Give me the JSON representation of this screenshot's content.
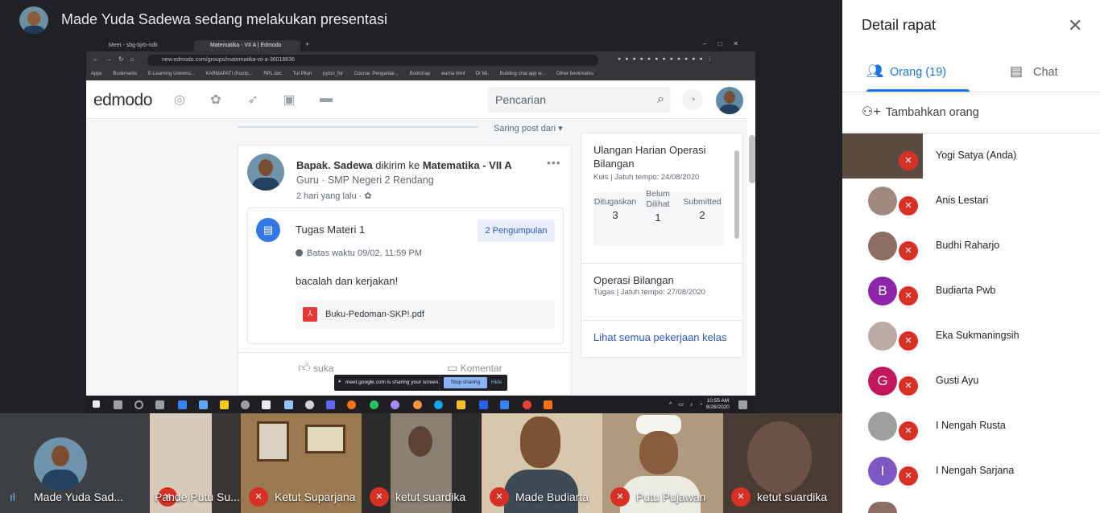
{
  "meet": {
    "presenter_title": "Made Yuda Sadewa sedang melakukan presentasi"
  },
  "browser": {
    "tabs": [
      "Meet - sbg-bjrb-ndk",
      "Matematika - VII A | Edmodo"
    ],
    "url": "new.edmodo.com/groups/matematika-vii-a-36018636",
    "bookmarks": [
      "Apps",
      "Bookmarks",
      "E-Learning Universi...",
      "KARMAPATI (Kump...",
      "RPL doc",
      "Tut Piton",
      "pyton_for",
      "Course: Pengantar...",
      "Bootstrap",
      "warna html",
      "DI ML",
      "Building chat app w...",
      "Other bookmarks"
    ]
  },
  "edmodo": {
    "logo": "edmodo",
    "search_placeholder": "Pencarian",
    "feed_filter": "Saring post dari",
    "post": {
      "author": "Bapak. Sadewa",
      "sent_to": "dikirim ke",
      "group": "Matematika - VII A",
      "role": "Guru · SMP Negeri 2 Rendang",
      "time": "2 hari yang lalu ·",
      "assignment_title": "Tugas Materi 1",
      "submissions": "2 Pengumpulan",
      "due": "Batas waktu 09/02, 11:59 PM",
      "description": "bacalah dan kerjakan!",
      "attachment": "Buku-Pedoman-SKP!.pdf",
      "like": "suka",
      "comment": "Komentar"
    },
    "due_items": [
      {
        "title": "Ulangan Harian Operasi Bilangan",
        "meta": "Kuis | Jatuh tempo: 24/08/2020"
      },
      {
        "title": "Operasi Bilangan",
        "meta": "Tugas | Jatuh tempo: 27/08/2020"
      }
    ],
    "stats": [
      {
        "label": "Ditugaskan",
        "value": "3"
      },
      {
        "label": "Belum Dilihat",
        "value": "1"
      },
      {
        "label": "Submitted",
        "value": "2"
      }
    ],
    "see_all": "Lihat semua pekerjaan kelas"
  },
  "share_bar": {
    "text": "meet.google.com is sharing your screen.",
    "stop": "Stop sharing",
    "hide": "Hide"
  },
  "taskbar": {
    "time": "10:55 AM",
    "date": "8/26/2020"
  },
  "panel": {
    "title": "Detail rapat",
    "tab_people": "Orang (19)",
    "tab_chat": "Chat",
    "add_people": "Tambahkan orang",
    "participants": [
      {
        "name": "Yogi Satya (Anda)",
        "initial": "",
        "color": "#6d4c41"
      },
      {
        "name": "Anis Lestari",
        "initial": "",
        "color": "#a1887f"
      },
      {
        "name": "Budhi Raharjo",
        "initial": "",
        "color": "#8d6e63"
      },
      {
        "name": "Budiarta Pwb",
        "initial": "B",
        "color": "#8e24aa"
      },
      {
        "name": "Eka Sukmaningsih",
        "initial": "",
        "color": "#bcaaa4"
      },
      {
        "name": "Gusti Ayu",
        "initial": "G",
        "color": "#c2185b"
      },
      {
        "name": "I Nengah Rusta",
        "initial": "",
        "color": "#9e9e9e"
      },
      {
        "name": "I Nengah Sarjana",
        "initial": "I",
        "color": "#7e57c2"
      }
    ]
  },
  "filmstrip": [
    {
      "name": "Made Yuda Sad...",
      "color": "#3c4043"
    },
    {
      "name": "Pande Putu Su...",
      "color": "#c9b8a6"
    },
    {
      "name": "Ketut Suparjana",
      "color": "#9c7a4f"
    },
    {
      "name": "ketut suardika",
      "color": "#7a7466"
    },
    {
      "name": "Made Budiarta",
      "color": "#d9c7ad"
    },
    {
      "name": "Putu Pujawan",
      "color": "#b09a7d"
    },
    {
      "name": "ketut suardika",
      "color": "#4a3b33"
    }
  ]
}
